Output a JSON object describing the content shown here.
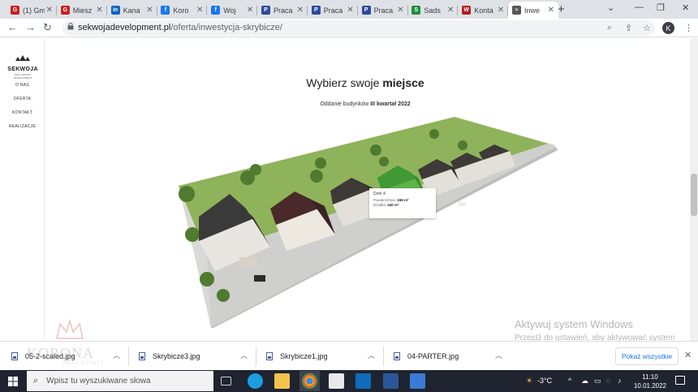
{
  "browser": {
    "tabs": [
      {
        "label": "(1) Gm",
        "icon": "gmail-icon",
        "color": "#c5221f",
        "glyph": "G"
      },
      {
        "label": "Miesz",
        "icon": "otodom-icon",
        "color": "#c5221f",
        "glyph": "G"
      },
      {
        "label": "Kana",
        "icon": "linkedin-icon",
        "color": "#0a66c2",
        "glyph": "in"
      },
      {
        "label": "Koro",
        "icon": "facebook-icon",
        "color": "#1877f2",
        "glyph": "f"
      },
      {
        "label": "Woj",
        "icon": "facebook-icon",
        "color": "#1877f2",
        "glyph": "f"
      },
      {
        "label": "Praca",
        "icon": "pracuj-icon",
        "color": "#2b4a9b",
        "glyph": "P"
      },
      {
        "label": "Praca",
        "icon": "pracuj-icon",
        "color": "#2b4a9b",
        "glyph": "P"
      },
      {
        "label": "Praca",
        "icon": "pracuj-icon",
        "color": "#2b4a9b",
        "glyph": "P"
      },
      {
        "label": "Sads",
        "icon": "sadsmart-icon",
        "color": "#1e8e3e",
        "glyph": "S"
      },
      {
        "label": "Konta",
        "icon": "bank-icon",
        "color": "#b71c1c",
        "glyph": "W"
      },
      {
        "label": "Inwe",
        "icon": "sekwoja-icon",
        "color": "#555555",
        "glyph": "≈"
      }
    ],
    "url_host": "sekwojadevelopment.pl",
    "url_path": "/oferta/inwestycja-skrybicze/",
    "profile_initial": "K"
  },
  "site": {
    "logo": "SEKWOJA",
    "logo_sub": "REAL ESTATE DEVELOPMENT",
    "nav": [
      "O NAS",
      "OFERTA",
      "KONTAKT",
      "REALIZACJE"
    ],
    "heading_prefix": "Wybierz swoje ",
    "heading_bold": "miejsce",
    "sub_prefix": "Oddanie budynków ",
    "sub_bold": "III kwartał 2022",
    "tooltip": {
      "title": "Dom 4",
      "area_label": "Powierzchnia:",
      "area_value": "156 m²",
      "plot_label": "Działka:",
      "plot_value": "440 m²"
    }
  },
  "windows_activation": {
    "title": "Aktywuj system Windows",
    "text": "Przejdź do ustawień, aby aktywować system Windows."
  },
  "downloads": {
    "items": [
      "05-2-scaled.jpg",
      "Skrybicze3.jpg",
      "Skrybicze1.jpg",
      "04-PARTER.jpg"
    ],
    "show_all": "Pokaż wszystkie"
  },
  "watermark": {
    "text": "KORONA",
    "sub": "REAL ESTATE"
  },
  "taskbar": {
    "search_placeholder": "Wpisz tu wyszukiwane słowa",
    "temperature": "-3°C",
    "time": "11:10",
    "date": "10.01.2022"
  }
}
